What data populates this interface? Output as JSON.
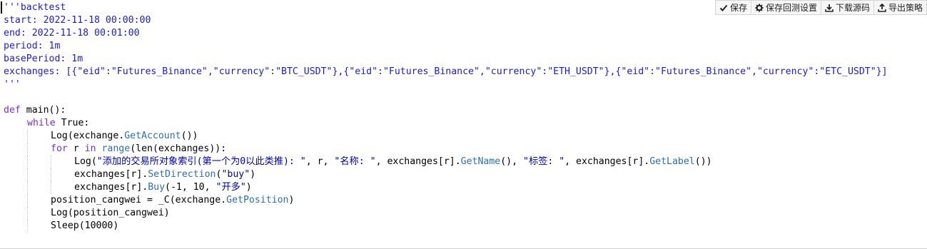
{
  "toolbar": {
    "buttons": [
      {
        "icon": "check-icon",
        "label": "保存"
      },
      {
        "icon": "gear-icon",
        "label": "保存回测设置"
      },
      {
        "icon": "download-icon",
        "label": "下载源码"
      },
      {
        "icon": "export-icon",
        "label": "导出策略"
      }
    ]
  },
  "code": {
    "header": [
      "'''backtest",
      "start: 2022-11-18 00:00:00",
      "end: 2022-11-18 00:01:00",
      "period: 1m",
      "basePeriod: 1m",
      "exchanges: [{\"eid\":\"Futures_Binance\",\"currency\":\"BTC_USDT\"},{\"eid\":\"Futures_Binance\",\"currency\":\"ETH_USDT\"},{\"eid\":\"Futures_Binance\",\"currency\":\"ETC_USDT\"}]",
      "'''"
    ],
    "def_kw": "def",
    "def_rest": " main():",
    "while_kw": "while",
    "while_rest": " True:",
    "log_account": {
      "pre": "Log(exchange.",
      "fn": "GetAccount",
      "post": "())"
    },
    "for_line": {
      "kw": "for",
      "var": " r ",
      "in": "in",
      "fn": " range",
      "rest": "(len(exchanges)):"
    },
    "log_names": {
      "pre": "Log(",
      "s1": "\"添加的交易所对象索引(第一个为0以此类推): \"",
      "mid1": ", r, ",
      "s2": "\"名称: \"",
      "mid2": ", exchanges[r].",
      "fn1": "GetName",
      "mid3": "(), ",
      "s3": "\"标签: \"",
      "mid4": ", exchanges[r].",
      "fn2": "GetLabel",
      "post": "())"
    },
    "set_direction": {
      "pre": "exchanges[r].",
      "fn": "SetDirection",
      "open": "(",
      "str": "\"buy\"",
      "post": ")"
    },
    "buy": {
      "pre": "exchanges[r].",
      "fn": "Buy",
      "args": "(-1, 10, ",
      "str": "\"开多\"",
      "post": ")"
    },
    "position": {
      "pre": "position_cangwei = _C(exchange.",
      "fn": "GetPosition",
      "post": ")"
    },
    "log_position": "Log(position_cangwei)",
    "sleep": "Sleep(10000)"
  }
}
